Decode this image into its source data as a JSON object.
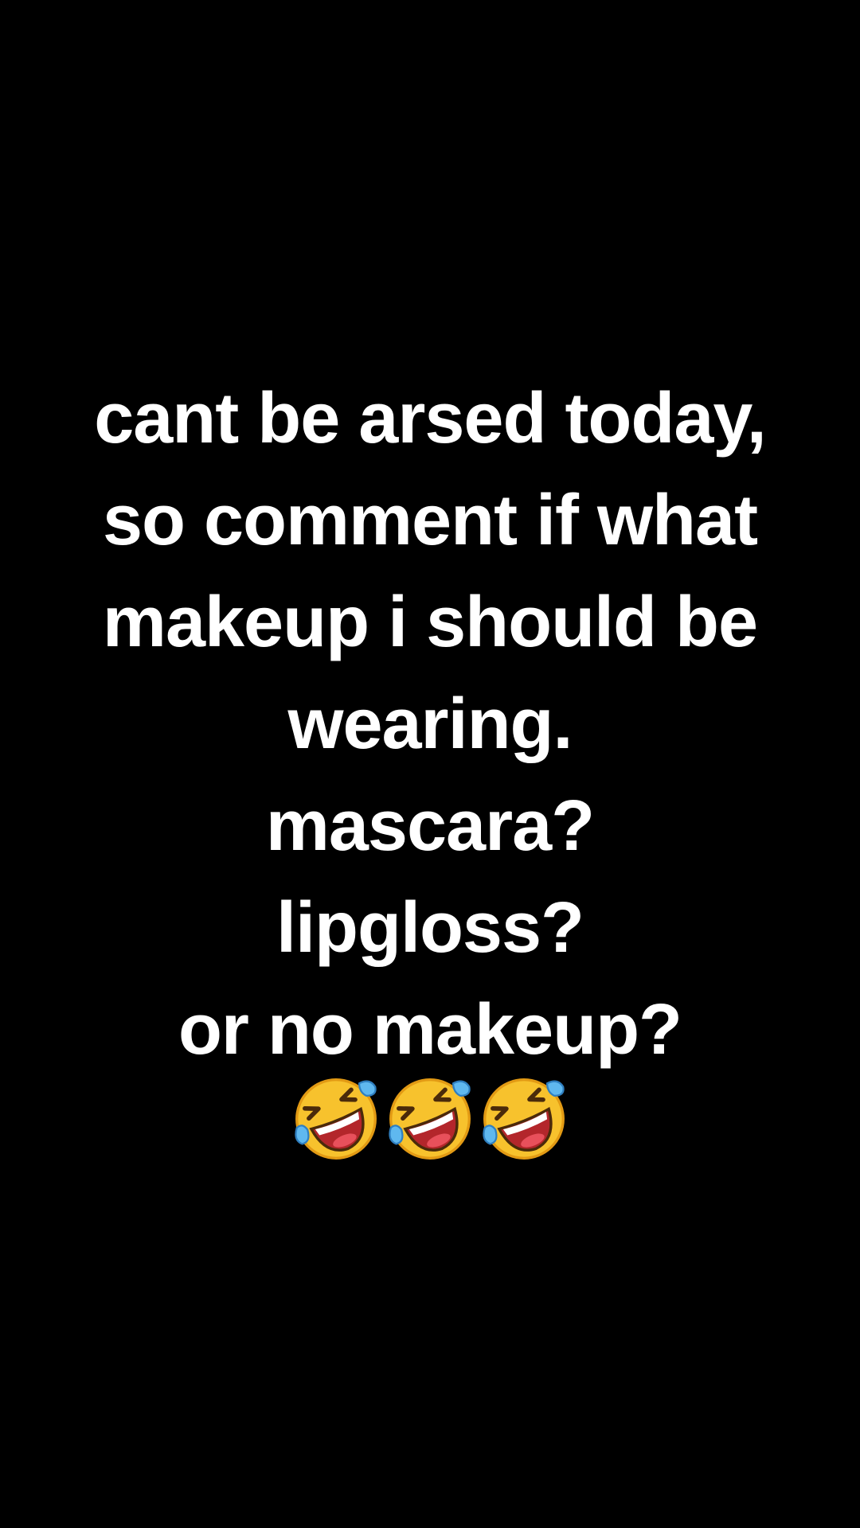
{
  "post": {
    "caption_lines": [
      "cant be arsed today,",
      "so comment if what",
      "makeup i should be",
      "wearing.",
      "mascara?",
      "lipgloss?",
      "or no makeup?"
    ],
    "emojis": [
      "rolling-on-floor-laughing-icon",
      "rolling-on-floor-laughing-icon",
      "rolling-on-floor-laughing-icon"
    ]
  },
  "colors": {
    "background": "#000000",
    "text": "#ffffff",
    "emoji_face": "#f7c22d",
    "emoji_tear": "#5fb8ef",
    "emoji_mouth": "#b3262b"
  }
}
